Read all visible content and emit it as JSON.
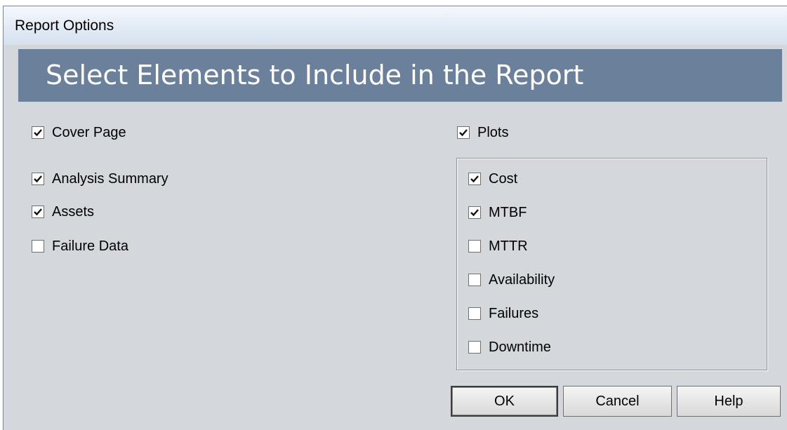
{
  "window": {
    "title": "Report Options"
  },
  "header": {
    "title": "Select Elements to Include in the Report"
  },
  "left_options": [
    {
      "label": "Cover Page",
      "checked": true
    },
    {
      "label": "Analysis Summary",
      "checked": true
    },
    {
      "label": "Assets",
      "checked": true
    },
    {
      "label": "Failure Data",
      "checked": false
    }
  ],
  "plots": {
    "label": "Plots",
    "checked": true,
    "items": [
      {
        "label": "Cost",
        "checked": true
      },
      {
        "label": "MTBF",
        "checked": true
      },
      {
        "label": "MTTR",
        "checked": false
      },
      {
        "label": "Availability",
        "checked": false
      },
      {
        "label": "Failures",
        "checked": false
      },
      {
        "label": "Downtime",
        "checked": false
      }
    ]
  },
  "buttons": {
    "ok_label": "OK",
    "cancel_label": "Cancel",
    "help_label": "Help"
  },
  "colors": {
    "banner": "#6b809b",
    "dialog_bg": "#d4d8dd"
  }
}
